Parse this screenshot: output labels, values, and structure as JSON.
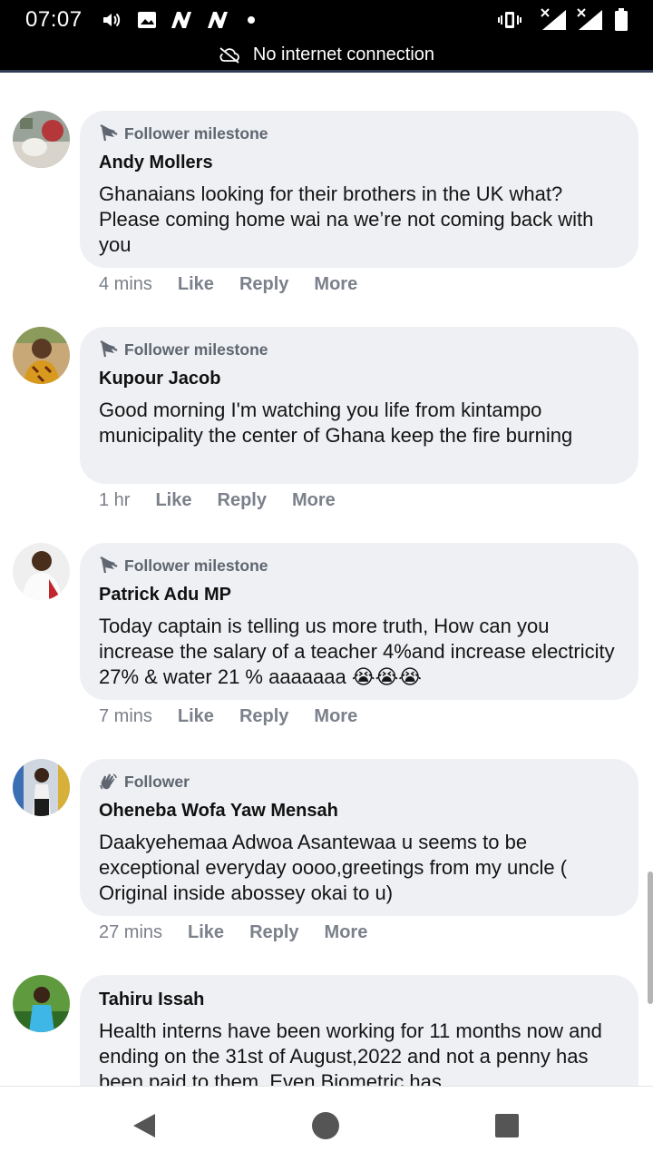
{
  "status": {
    "time": "07:07",
    "offline_text": "No internet connection",
    "icons": [
      "volume-icon",
      "image-icon",
      "n-app-icon",
      "n-app-icon",
      "dot-icon",
      "vibrate-icon",
      "signal-icon",
      "signal-icon",
      "battery-icon"
    ]
  },
  "comments": [
    {
      "badge": "Follower milestone",
      "badge_icon": "flag-icon",
      "author": "Andy Mollers",
      "text": "Ghanaians looking for their brothers in the UK what? Please coming home wai na we’re not coming back with you",
      "time": "4 mins",
      "like": "Like",
      "reply": "Reply",
      "more": "More"
    },
    {
      "badge": "Follower milestone",
      "badge_icon": "flag-icon",
      "author": "Kupour Jacob",
      "text": "Good morning I'm watching you life from kintampo municipality the center of Ghana keep the fire burning",
      "time": "1 hr",
      "like": "Like",
      "reply": "Reply",
      "more": "More"
    },
    {
      "badge": "Follower milestone",
      "badge_icon": "flag-icon",
      "author": "Patrick Adu MP",
      "text": "Today captain is telling us more truth, How can you increase the salary of a teacher 4%and increase electricity 27% & water 21 % aaaaaaa 😭😭😭",
      "time": "7 mins",
      "like": "Like",
      "reply": "Reply",
      "more": "More"
    },
    {
      "badge": "Follower",
      "badge_icon": "wave-hand-icon",
      "author": "Oheneba Wofa Yaw Mensah",
      "text": "Daakyehemaa Adwoa Asantewaa u seems to be exceptional everyday oooo,greetings from my uncle ( Original inside abossey okai to u)",
      "time": "27 mins",
      "like": "Like",
      "reply": "Reply",
      "more": "More"
    },
    {
      "author": "Tahiru Issah",
      "text": "Health interns have been working for 11 months now and ending on the 31st of August,2022 and not a penny has been paid to them. Even Biometric has"
    }
  ],
  "colors": {
    "bubble": "#eef0f3",
    "action_text": "#7b808a",
    "badge_text": "#5f6670",
    "status_bar": "#000000"
  }
}
